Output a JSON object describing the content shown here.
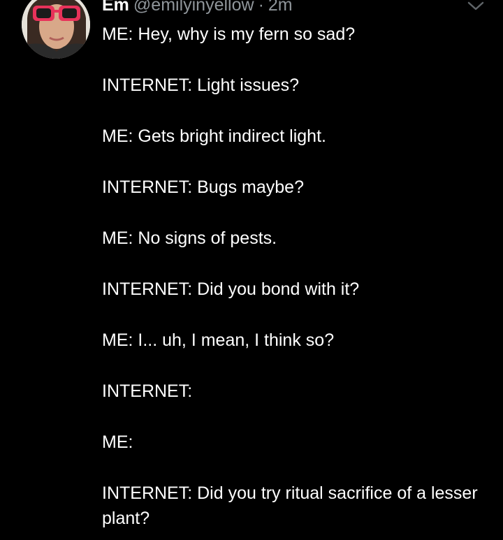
{
  "tweet": {
    "display_name": "Em",
    "handle": "@emilyinyellow",
    "separator": "·",
    "time": "2m",
    "lines": [
      "ME: Hey, why is my fern so sad?",
      "INTERNET: Light issues?",
      "ME: Gets bright indirect light.",
      "INTERNET: Bugs maybe?",
      "ME: No signs of pests.",
      "INTERNET: Did you bond with it?",
      "ME: I... uh, I mean, I think so?",
      "INTERNET:",
      "ME:",
      "INTERNET: Did you try ritual sacrifice of a lesser plant?"
    ]
  },
  "icons": {
    "avatar": "avatar",
    "menu": "chevron-down-icon"
  },
  "colors": {
    "background": "#000000",
    "text": "#ffffff",
    "secondary": "#8f959a",
    "sunglasses": "#e8325a"
  }
}
